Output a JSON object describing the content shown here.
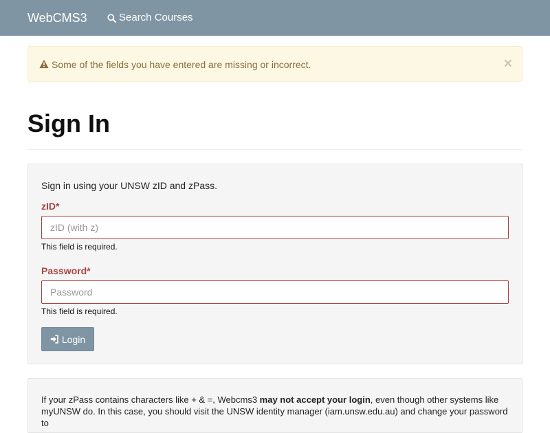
{
  "navbar": {
    "brand": "WebCMS3",
    "search_label": "Search Courses",
    "search_icon": "search-icon",
    "background": "#7f95a3"
  },
  "alert": {
    "message": "Some of the fields you have entered are missing or incorrect.",
    "icon": "warning-icon",
    "close_symbol": "×",
    "background": "#fcf8e3",
    "text_color": "#8a6d3b"
  },
  "page": {
    "title": "Sign In"
  },
  "form": {
    "intro": "Sign in using your UNSW zID and zPass.",
    "zid": {
      "label": "zID*",
      "placeholder": "zID (with z)",
      "value": "",
      "help": "This field is required."
    },
    "password": {
      "label": "Password*",
      "placeholder": "Password",
      "value": "",
      "help": "This field is required."
    },
    "login_label": "Login",
    "login_icon": "sign-in-icon",
    "error_color": "#a94442"
  },
  "info": {
    "text_before": "If your zPass contains characters like + & =, Webcms3 ",
    "text_bold": "may not accept your login",
    "text_after": ", even though other systems like myUNSW do. In this case, you should visit the UNSW identity manager (iam.unsw.edu.au) and change your password to"
  }
}
